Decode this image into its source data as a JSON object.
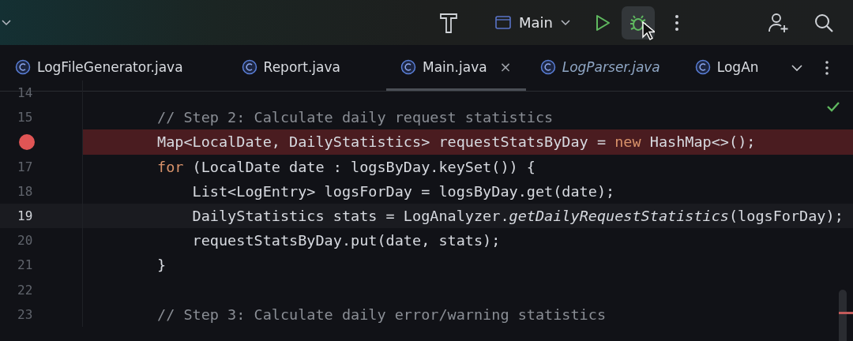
{
  "toolbar": {
    "run_config": "Main",
    "debug_hovered": true
  },
  "tabs": [
    {
      "label": "LogFileGenerator.java",
      "selected": false,
      "italic": false,
      "closable": false
    },
    {
      "label": "Report.java",
      "selected": false,
      "italic": false,
      "closable": false
    },
    {
      "label": "Main.java",
      "selected": true,
      "italic": false,
      "closable": true,
      "close": "×"
    },
    {
      "label": "LogParser.java",
      "selected": false,
      "italic": true,
      "closable": false
    },
    {
      "label": "LogAn",
      "selected": false,
      "italic": false,
      "closable": false
    }
  ],
  "editor": {
    "lines": [
      {
        "number": "14",
        "breakpoint": false,
        "current": false
      },
      {
        "number": "15",
        "breakpoint": false,
        "current": false,
        "segments": [
          {
            "kind": "comment",
            "text": "// Step 2: Calculate daily request statistics"
          }
        ]
      },
      {
        "breakpoint": true,
        "current": false,
        "segments": [
          {
            "kind": "plain",
            "text": "Map<LocalDate, DailyStatistics> requestStatsByDay = "
          },
          {
            "kind": "keyword",
            "text": "new"
          },
          {
            "kind": "plain",
            "text": " HashMap<>();"
          }
        ]
      },
      {
        "number": "17",
        "breakpoint": false,
        "current": false,
        "segments": [
          {
            "kind": "keyword",
            "text": "for"
          },
          {
            "kind": "plain",
            "text": " (LocalDate date : logsByDay.keySet()) {"
          }
        ]
      },
      {
        "number": "18",
        "breakpoint": false,
        "current": false,
        "segments": [
          {
            "kind": "plain",
            "text": "    List<LogEntry> logsForDay = logsByDay.get(date);"
          }
        ]
      },
      {
        "number": "19",
        "breakpoint": false,
        "current": true,
        "segments": [
          {
            "kind": "plain",
            "text": "    DailyStatistics stats = LogAnalyzer."
          },
          {
            "kind": "static",
            "text": "getDailyRequestStatistics"
          },
          {
            "kind": "plain",
            "text": "(logsForDay);"
          }
        ]
      },
      {
        "number": "20",
        "breakpoint": false,
        "current": false,
        "segments": [
          {
            "kind": "plain",
            "text": "    requestStatsByDay.put(date, stats);"
          }
        ]
      },
      {
        "number": "21",
        "breakpoint": false,
        "current": false,
        "segments": [
          {
            "kind": "plain",
            "text": "}"
          }
        ]
      },
      {
        "number": "22",
        "breakpoint": false,
        "current": false
      },
      {
        "number": "23",
        "breakpoint": false,
        "current": false,
        "segments": [
          {
            "kind": "comment",
            "text": "// Step 3: Calculate daily error/warning statistics"
          }
        ]
      }
    ]
  }
}
